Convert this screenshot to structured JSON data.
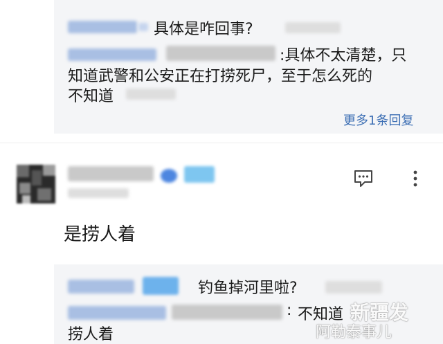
{
  "thread1": {
    "reply1_text": "具体是咋回事?",
    "reply2_line1": ":具体不太清楚，只",
    "reply2_line2": "知道武警和公安正在打捞死尸，至于怎么死的",
    "reply2_line3": "不知道",
    "more_replies_label": "更多1条回复"
  },
  "comment": {
    "text": "是捞人着",
    "icons": [
      "comment-icon",
      "more-vertical-icon"
    ]
  },
  "thread2": {
    "reply1_text": "钓鱼掉河里啦?",
    "reply2_prefix": ":",
    "reply2_line1": "不知道",
    "reply2_line2": "捞人着"
  },
  "watermark": {
    "line1": "新疆发",
    "line2": "阿勒泰事儿"
  },
  "colors": {
    "link": "#3d6fb4",
    "reply_background": "#f4f5f7",
    "text": "#1a1a1a",
    "blurred_name": "#a9bfe3"
  }
}
